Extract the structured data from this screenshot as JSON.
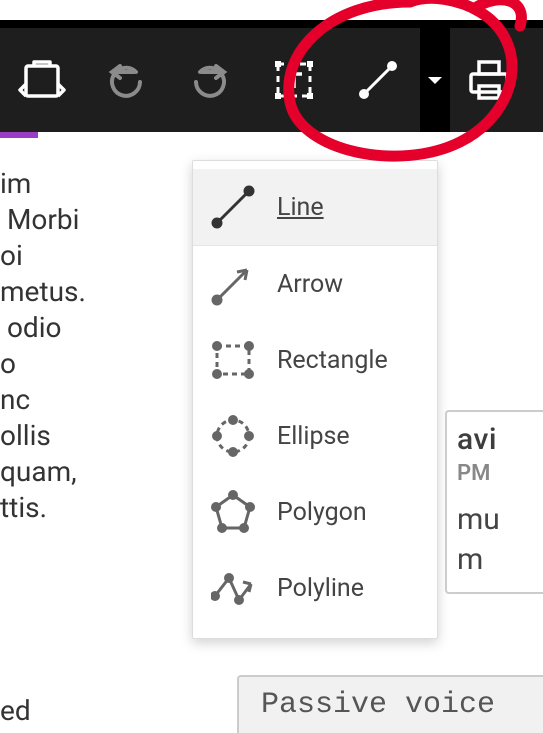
{
  "toolbar": {
    "items": [
      {
        "name": "clipboard-icon"
      },
      {
        "name": "undo-icon"
      },
      {
        "name": "redo-icon"
      },
      {
        "name": "text-frame-icon"
      },
      {
        "name": "line-tool-icon"
      },
      {
        "name": "shape-dropdown-caret"
      },
      {
        "name": "printer-icon"
      }
    ]
  },
  "shapeMenu": {
    "items": [
      {
        "label": "Line"
      },
      {
        "label": "Arrow"
      },
      {
        "label": "Rectangle"
      },
      {
        "label": "Ellipse"
      },
      {
        "label": "Polygon"
      },
      {
        "label": "Polyline"
      }
    ]
  },
  "doc": {
    "lines": [
      "im",
      " Morbi",
      "oi",
      "metus.",
      " odio",
      "",
      "",
      "o",
      "nc",
      "",
      "ollis",
      "quam,",
      "ttis.",
      "",
      "",
      "ed"
    ]
  },
  "sidecard": {
    "name": "avi",
    "time": " PM",
    "line1": "mu",
    "line2": "m"
  },
  "bottom": {
    "text": "Passive voice"
  }
}
